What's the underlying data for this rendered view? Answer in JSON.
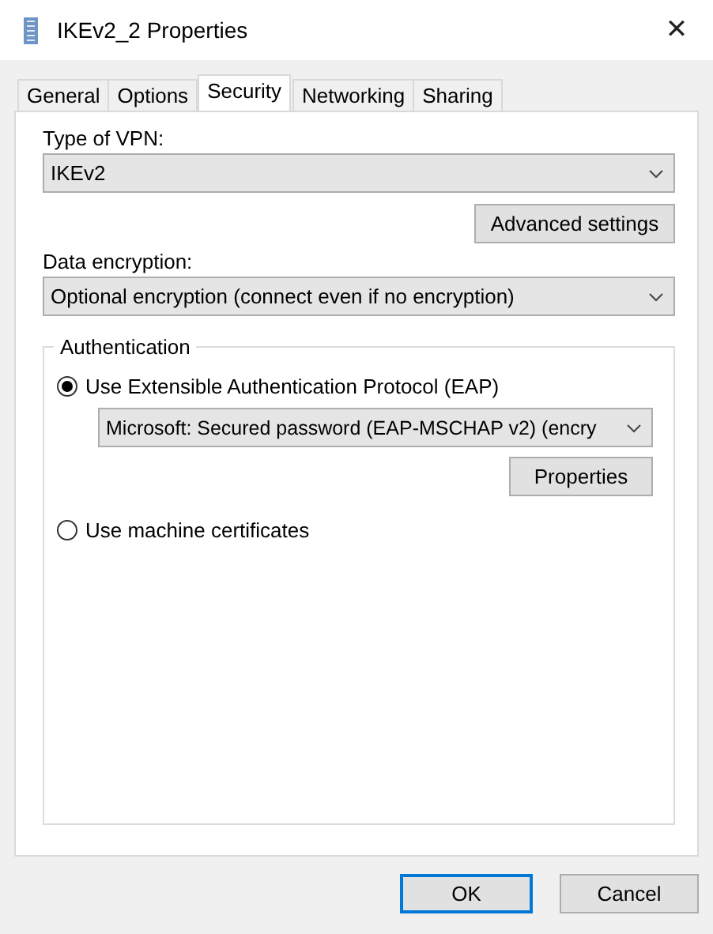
{
  "window": {
    "title": "IKEv2_2 Properties",
    "close": "✕"
  },
  "tabs": [
    {
      "label": "General",
      "selected": false
    },
    {
      "label": "Options",
      "selected": false
    },
    {
      "label": "Security",
      "selected": true
    },
    {
      "label": "Networking",
      "selected": false
    },
    {
      "label": "Sharing",
      "selected": false
    }
  ],
  "vpn_type": {
    "label": "Type of VPN:",
    "value": "IKEv2"
  },
  "advanced_button": "Advanced settings",
  "data_encryption": {
    "label": "Data encryption:",
    "value": "Optional encryption (connect even if no encryption)"
  },
  "authentication": {
    "legend": "Authentication",
    "options": [
      {
        "label": "Use Extensible Authentication Protocol (EAP)",
        "selected": true,
        "method": "Microsoft: Secured password (EAP-MSCHAP v2) (encry",
        "button": "Properties"
      },
      {
        "label": "Use machine certificates",
        "selected": false
      }
    ]
  },
  "buttons": [
    {
      "label": "OK",
      "default": true
    },
    {
      "label": "Cancel",
      "default": false
    }
  ]
}
